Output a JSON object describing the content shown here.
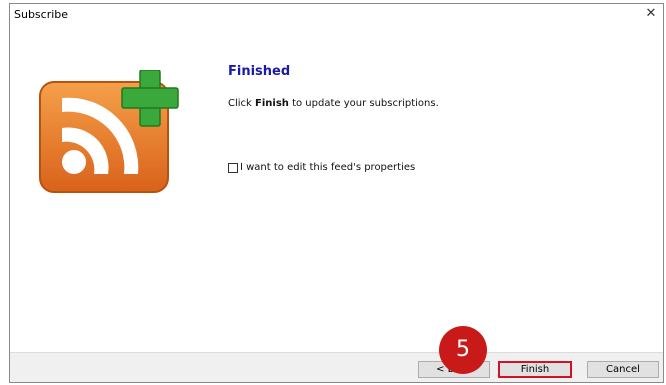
{
  "window": {
    "title": "Subscribe",
    "close_glyph": "✕"
  },
  "content": {
    "heading": "Finished",
    "instruction_prefix": "Click ",
    "instruction_bold": "Finish",
    "instruction_suffix": " to update your subscriptions.",
    "checkbox_label": "I want to edit this feed's properties",
    "checkbox_checked": false
  },
  "icon": {
    "name": "rss-subscribe-icon",
    "rss_color": "#e8761e",
    "plus_color": "#3aa83a"
  },
  "buttons": {
    "back": "< Back",
    "finish": "Finish",
    "cancel": "Cancel"
  },
  "annotation": {
    "step_number": "5",
    "color": "#c91a1a"
  }
}
